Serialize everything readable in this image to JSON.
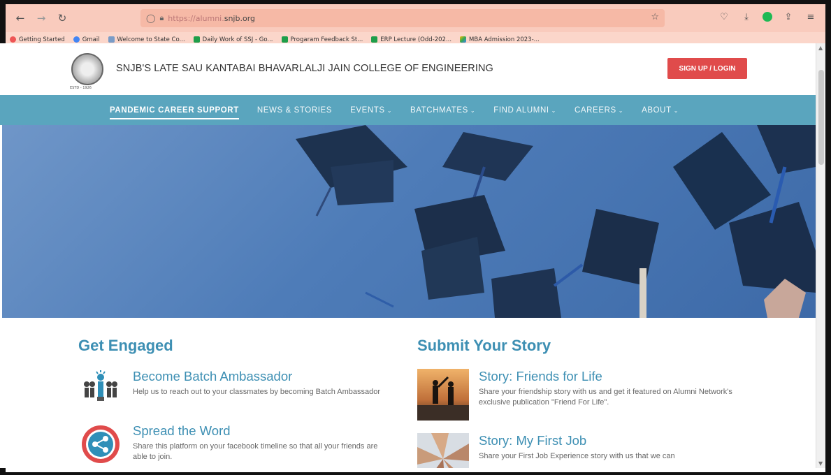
{
  "browser": {
    "url_prefix": "https://alumni.",
    "url_domain": "snjb.org",
    "bookmarks": [
      {
        "label": "Getting Started"
      },
      {
        "label": "Gmail"
      },
      {
        "label": "Welcome to State Co..."
      },
      {
        "label": "Daily Work of SSJ - Go..."
      },
      {
        "label": "Progaram Feedback St..."
      },
      {
        "label": "ERP Lecture (Odd-202..."
      },
      {
        "label": "MBA Admission 2023-..."
      }
    ]
  },
  "header": {
    "logo_text": "ESTD - 1926",
    "college_name": "SNJB'S LATE SAU KANTABAI BHAVARLALJI JAIN COLLEGE OF ENGINEERING",
    "signup_label": "SIGN UP / LOGIN"
  },
  "nav": {
    "items": [
      {
        "label": "PANDEMIC CAREER SUPPORT",
        "caret": ""
      },
      {
        "label": "NEWS & STORIES",
        "caret": ""
      },
      {
        "label": "EVENTS",
        "caret": "⌄"
      },
      {
        "label": "BATCHMATES",
        "caret": "⌄"
      },
      {
        "label": "FIND ALUMNI",
        "caret": "⌄"
      },
      {
        "label": "CAREERS",
        "caret": "⌄"
      },
      {
        "label": "ABOUT",
        "caret": "⌄"
      }
    ]
  },
  "get_engaged": {
    "title": "Get Engaged",
    "items": [
      {
        "title": "Become Batch Ambassador",
        "desc": "Help us to reach out to your classmates by becoming Batch Ambassador"
      },
      {
        "title": "Spread the Word",
        "desc": "Share this platform on your facebook timeline so that all your friends are able to join."
      }
    ]
  },
  "submit_story": {
    "title": "Submit Your Story",
    "items": [
      {
        "title": "Story: Friends for Life",
        "desc": "Share your friendship story with us and get it featured on Alumni Network's exclusive publication \"Friend For Life\"."
      },
      {
        "title": "Story: My First Job",
        "desc": "Share your First Job Experience story with us that we can"
      }
    ]
  },
  "colors": {
    "nav_bg": "#5aa5be",
    "accent": "#3d8fb3",
    "signup_bg": "#e04b4b",
    "toolbar_bg": "#f9cbbd"
  }
}
